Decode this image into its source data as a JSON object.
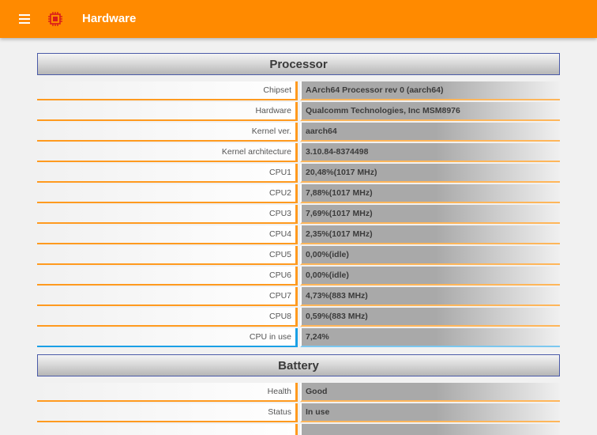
{
  "appbar": {
    "title": "Hardware",
    "color": "#ff8a00",
    "menu_icon": "hamburger-menu-icon",
    "app_icon": "chip-icon"
  },
  "processor": {
    "title": "Processor",
    "rows": [
      {
        "label": "Chipset",
        "value": "AArch64 Processor rev 0 (aarch64)"
      },
      {
        "label": "Hardware",
        "value": "Qualcomm Technologies, Inc MSM8976"
      },
      {
        "label": "Kernel ver.",
        "value": "aarch64"
      },
      {
        "label": "Kernel architecture",
        "value": "3.10.84-8374498"
      },
      {
        "label": "CPU1",
        "value": "20,48%(1017 MHz)"
      },
      {
        "label": "CPU2",
        "value": "7,88%(1017 MHz)"
      },
      {
        "label": "CPU3",
        "value": "7,69%(1017 MHz)"
      },
      {
        "label": "CPU4",
        "value": "2,35%(1017 MHz)"
      },
      {
        "label": "CPU5",
        "value": "0,00%(idle)"
      },
      {
        "label": "CPU6",
        "value": "0,00%(idle)"
      },
      {
        "label": "CPU7",
        "value": "4,73%(883 MHz)"
      },
      {
        "label": "CPU8",
        "value": "0,59%(883 MHz)"
      },
      {
        "label": "CPU in use",
        "value": "7,24%"
      }
    ]
  },
  "battery": {
    "title": "Battery",
    "rows": [
      {
        "label": "Health",
        "value": "Good"
      },
      {
        "label": "Status",
        "value": "In use"
      },
      {
        "label": "",
        "value": ""
      }
    ]
  },
  "colors": {
    "accent_orange": "#ff9a1f",
    "accent_blue": "#1aa0e6",
    "header_border": "#4a5aa8"
  }
}
